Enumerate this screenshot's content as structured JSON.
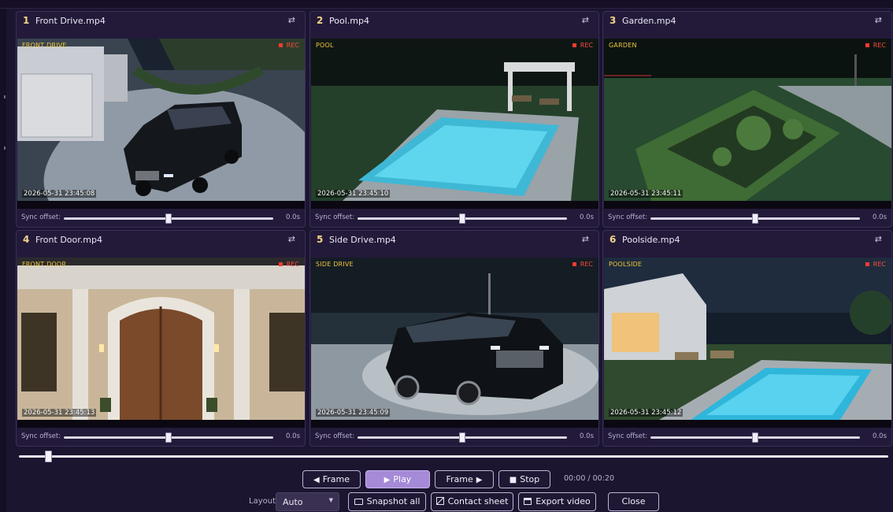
{
  "tiles": [
    {
      "num": "1",
      "file": "Front Drive.mp4",
      "cam_label": "FRONT DRIVE",
      "rec": "REC",
      "timestamp": "2026-05-31 23:45:08",
      "sync_label": "Sync offset:",
      "sync_value": "0.0s",
      "sync_fraction": 0.5,
      "swap_icon": "⇄"
    },
    {
      "num": "2",
      "file": "Pool.mp4",
      "cam_label": "POOL",
      "rec": "REC",
      "timestamp": "2026-05-31 23:45:10",
      "sync_label": "Sync offset:",
      "sync_value": "0.0s",
      "sync_fraction": 0.5,
      "swap_icon": "⇄"
    },
    {
      "num": "3",
      "file": "Garden.mp4",
      "cam_label": "GARDEN",
      "rec": "REC",
      "timestamp": "2026-05-31 23:45:11",
      "sync_label": "Sync offset:",
      "sync_value": "0.0s",
      "sync_fraction": 0.5,
      "swap_icon": "⇄"
    },
    {
      "num": "4",
      "file": "Front Door.mp4",
      "cam_label": "FRONT DOOR",
      "rec": "REC",
      "timestamp": "2026-05-31 23:45:13",
      "sync_label": "Sync offset:",
      "sync_value": "0.0s",
      "sync_fraction": 0.5,
      "swap_icon": "⇄"
    },
    {
      "num": "5",
      "file": "Side Drive.mp4",
      "cam_label": "SIDE DRIVE",
      "rec": "REC",
      "timestamp": "2026-05-31 23:45:09",
      "sync_label": "Sync offset:",
      "sync_value": "0.0s",
      "sync_fraction": 0.5,
      "swap_icon": "⇄"
    },
    {
      "num": "6",
      "file": "Poolside.mp4",
      "cam_label": "POOLSIDE",
      "rec": "REC",
      "timestamp": "2026-05-31 23:45:12",
      "sync_label": "Sync offset:",
      "sync_value": "0.0s",
      "sync_fraction": 0.5,
      "swap_icon": "⇄"
    }
  ],
  "timeline": {
    "position_fraction": 0.03
  },
  "controls": {
    "frame_back": "Frame",
    "play": "Play",
    "frame_forward": "Frame",
    "stop": "Stop",
    "time": "00:00 / 00:20",
    "layout_label": "Layout:",
    "layout_value": "Auto",
    "snapshot_all": "Snapshot all",
    "contact_sheet": "Contact sheet",
    "export_video": "Export video",
    "close": "Close"
  },
  "colors": {
    "accent": "#a68ad8",
    "rec": "#ff3b30",
    "cam_label": "#f0c63c",
    "background": "#1c1530"
  }
}
